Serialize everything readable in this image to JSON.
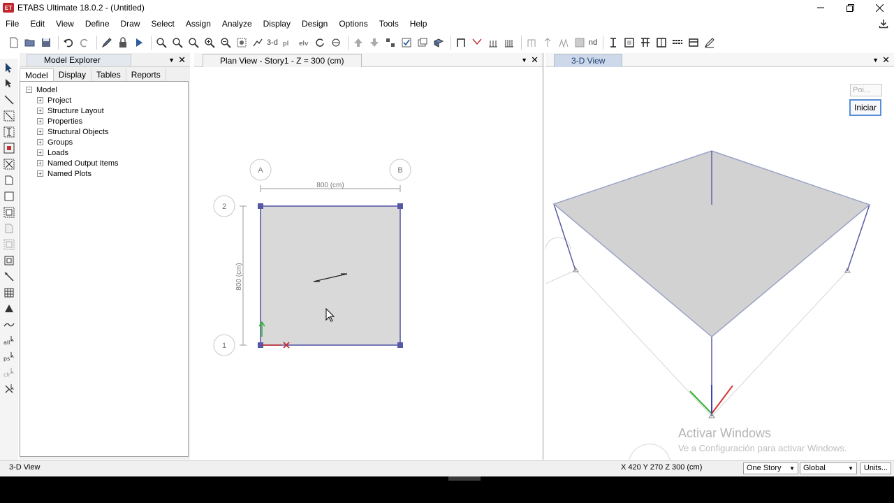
{
  "titlebar": {
    "app_icon_text": "ET",
    "title": "ETABS Ultimate 18.0.2 - (Untitled)"
  },
  "menu": [
    "File",
    "Edit",
    "View",
    "Define",
    "Draw",
    "Select",
    "Assign",
    "Analyze",
    "Display",
    "Design",
    "Options",
    "Tools",
    "Help"
  ],
  "toolbar": {
    "text_3d": "3-d",
    "text_nd": "nd"
  },
  "explorer": {
    "title": "Model Explorer",
    "tabs": [
      "Model",
      "Display",
      "Tables",
      "Reports"
    ],
    "root": "Model",
    "items": [
      "Project",
      "Structure Layout",
      "Properties",
      "Structural Objects",
      "Groups",
      "Loads",
      "Named Output Items",
      "Named Plots"
    ]
  },
  "plan": {
    "tab": "Plan View - Story1 - Z = 300 (cm)",
    "grid_a": "A",
    "grid_b": "B",
    "grid_1": "1",
    "grid_2": "2",
    "dim_x": "800 (cm)",
    "dim_y": "800 (cm)"
  },
  "view3d": {
    "tab": "3-D View",
    "poi_placeholder": "Poi...",
    "iniciar": "Iniciar",
    "watermark_title": "Activar Windows",
    "watermark_sub": "Ve a Configuración para activar Windows."
  },
  "status": {
    "left": "3-D View",
    "coords": "X 420  Y 270  Z 300 (cm)",
    "story": "One Story",
    "coord_sys": "Global",
    "units": "Units..."
  },
  "colors": {
    "accent": "#5a8fd8",
    "slab": "#d9d9d9",
    "frame": "#5a5aa8",
    "joint": "#5458a6"
  }
}
